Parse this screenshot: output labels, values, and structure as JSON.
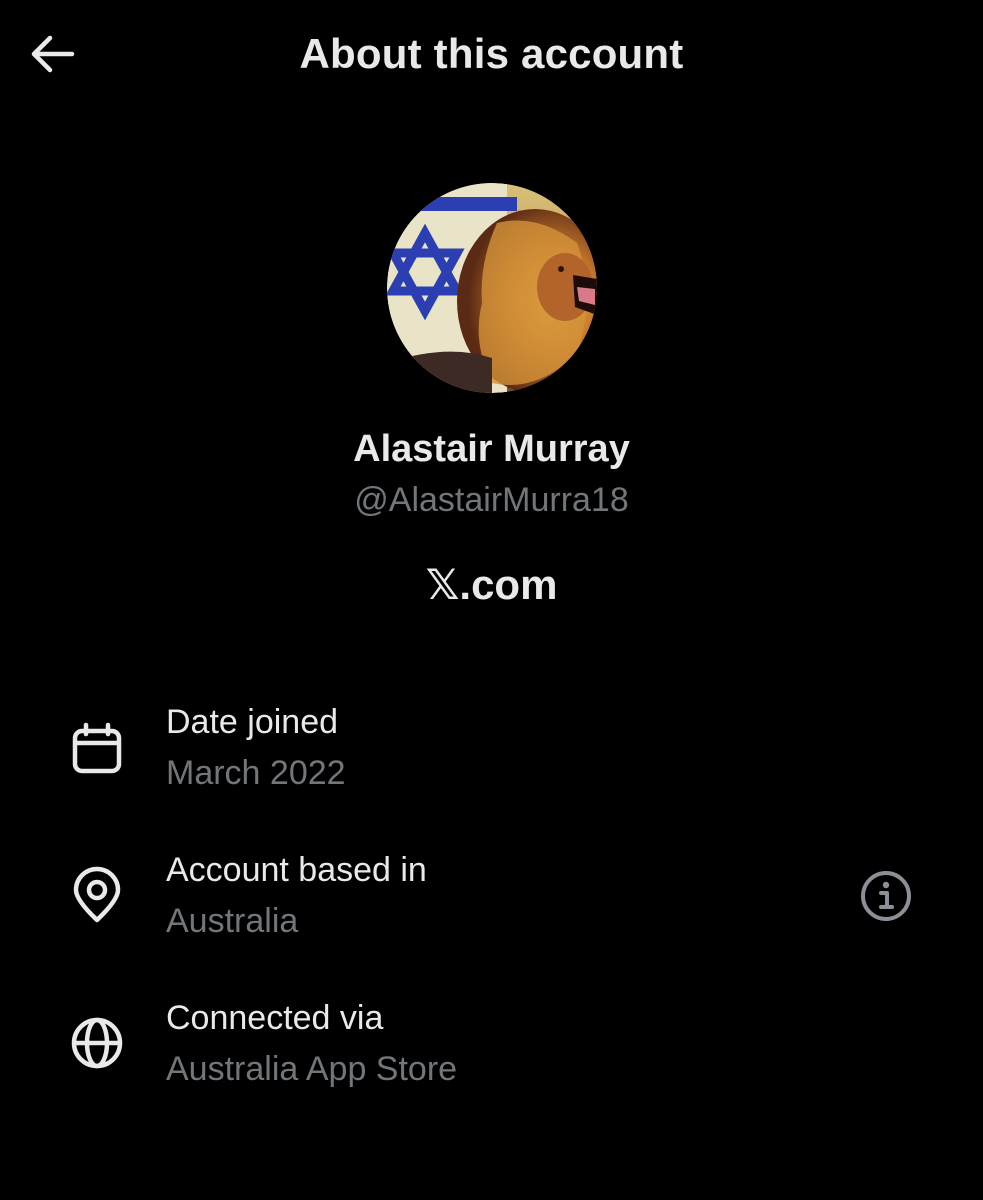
{
  "header": {
    "title": "About this account",
    "back_icon": "arrow-left-icon"
  },
  "profile": {
    "display_name": "Alastair Murray",
    "handle": "@AlastairMurra18",
    "site_logo_glyph": "𝕏",
    "site_suffix": ".com"
  },
  "details": [
    {
      "icon": "calendar-icon",
      "label": "Date joined",
      "value": "March 2022"
    },
    {
      "icon": "location-pin-icon",
      "label": "Account based in",
      "value": "Australia",
      "action_icon": "info-icon"
    },
    {
      "icon": "globe-icon",
      "label": "Connected via",
      "value": "Australia App Store"
    }
  ],
  "colors": {
    "background": "#000000",
    "primary_text": "#e7e9ea",
    "secondary_text": "#71767b"
  }
}
